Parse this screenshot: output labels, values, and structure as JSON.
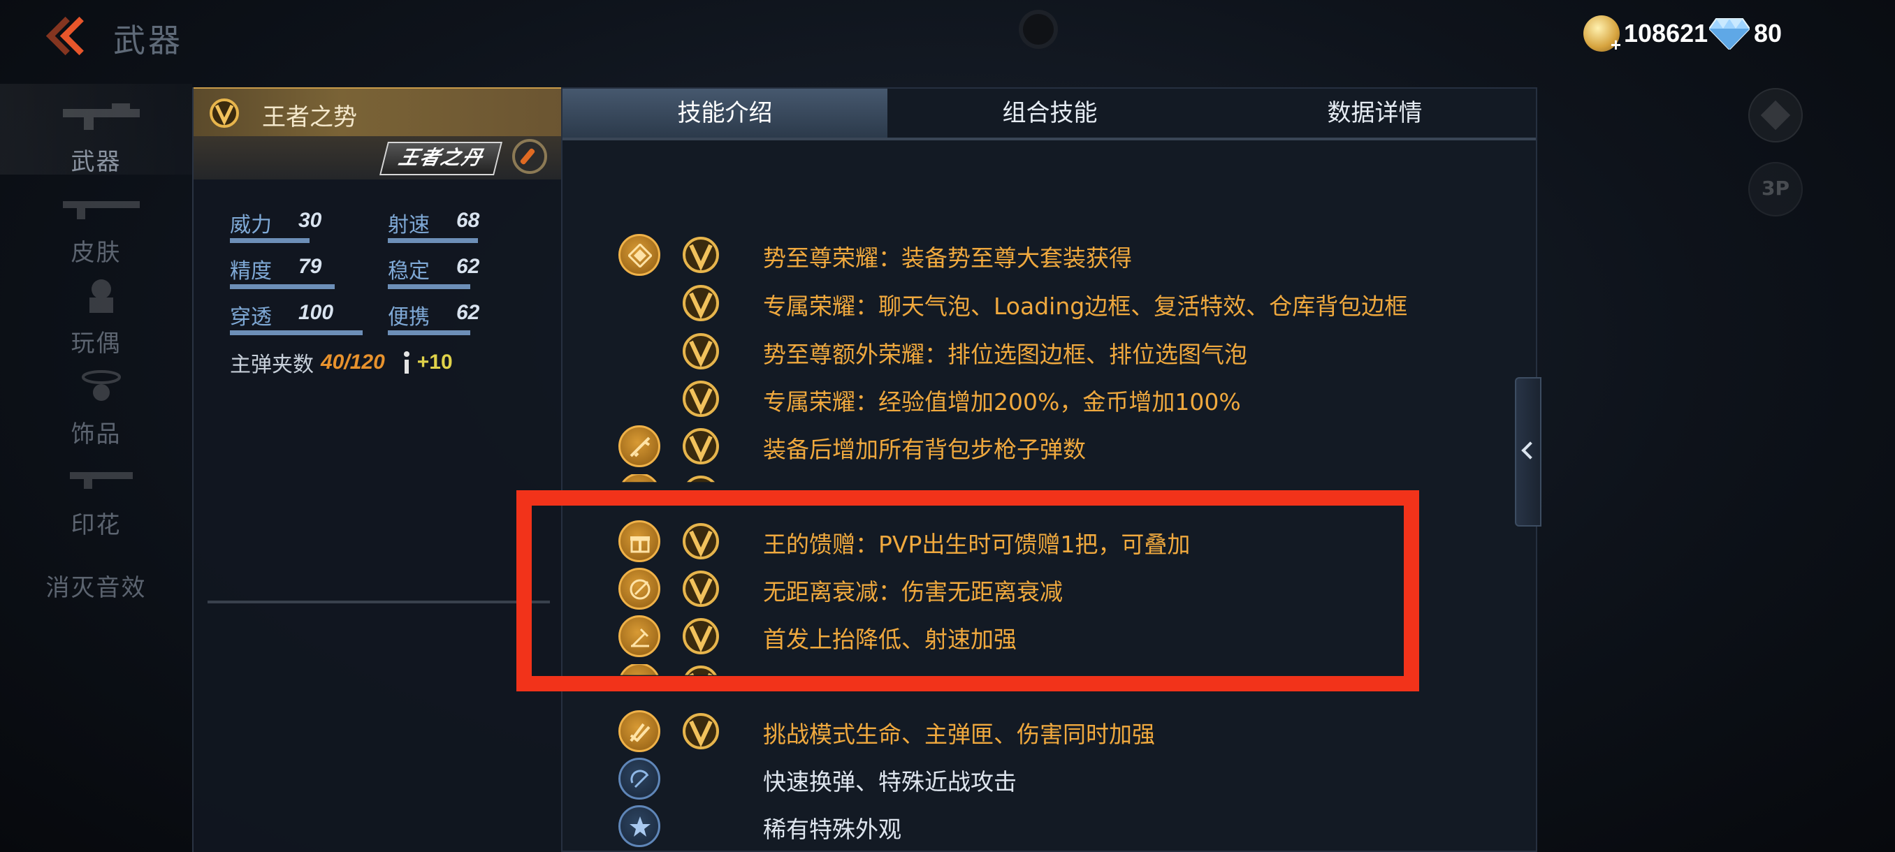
{
  "header": {
    "title": "武器"
  },
  "currency": {
    "gold": "108621",
    "diamond": "80"
  },
  "nav": {
    "items": [
      {
        "label": "武器",
        "icon": "rifle-icon",
        "active": true
      },
      {
        "label": "皮肤",
        "icon": "skin-icon"
      },
      {
        "label": "玩偶",
        "icon": "doll-icon"
      },
      {
        "label": "饰品",
        "icon": "ornament-icon"
      },
      {
        "label": "印花",
        "icon": "decal-icon"
      },
      {
        "label": "消灭音效",
        "icon": "sound-icon"
      }
    ]
  },
  "weapon": {
    "name": "王者之势",
    "logo_text": "王者之丹",
    "stats": [
      {
        "label": "威力",
        "value": "30",
        "level": 0.6
      },
      {
        "label": "射速",
        "value": "68",
        "level": 0.68
      },
      {
        "label": "精度",
        "value": "79",
        "level": 0.79
      },
      {
        "label": "稳定",
        "value": "62",
        "level": 0.62
      },
      {
        "label": "穿透",
        "value": "100",
        "level": 1.0
      },
      {
        "label": "便携",
        "value": "62",
        "level": 0.62
      }
    ],
    "ammo_label": "主弹夹数",
    "ammo_value": "40/120",
    "ammo_bonus": "+10"
  },
  "tabs": [
    {
      "label": "技能介绍",
      "active": true
    },
    {
      "label": "组合技能"
    },
    {
      "label": "数据详情"
    }
  ],
  "skills": [
    {
      "icon": "diamond-emblem-icon",
      "text": "势至尊荣耀：装备势至尊大套装获得"
    },
    {
      "icon": "",
      "text": "专属荣耀：聊天气泡、Loading边框、复活特效、仓库背包边框"
    },
    {
      "icon": "",
      "text": "势至尊额外荣耀：排位选图边框、排位选图气泡"
    },
    {
      "icon": "",
      "text": "专属荣耀：经验值增加200%，金币增加100%"
    },
    {
      "icon": "rifle-ammo-icon",
      "text": "装备后增加所有背包步枪子弹数"
    },
    {
      "icon": "partial-icon",
      "text": ""
    },
    {
      "icon": "gift-icon",
      "text": "王的馈赠：PVP出生时可馈赠1把，可叠加"
    },
    {
      "icon": "target-icon",
      "text": "无距离衰减：伤害无距离衰减"
    },
    {
      "icon": "recoil-icon",
      "text": "首发上抬降低、射速加强"
    },
    {
      "icon": "partial-icon",
      "text": ""
    },
    {
      "icon": "challenge-icon",
      "text": "挑战模式生命、主弹匣、伤害同时加强"
    },
    {
      "icon": "reload-icon",
      "text": "快速换弹、特殊近战攻击"
    },
    {
      "icon": "star-icon",
      "text": "稀有特殊外观"
    }
  ],
  "colors": {
    "highlight": "#f2331a",
    "skill_text": "#f0a93e",
    "accent": "#e8562b"
  }
}
